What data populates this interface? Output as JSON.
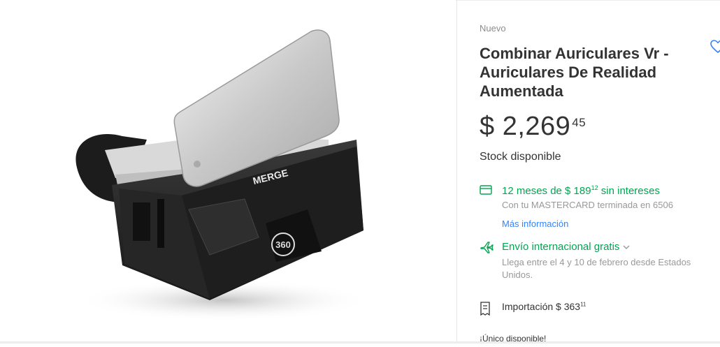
{
  "product": {
    "condition": "Nuevo",
    "title": "Combinar Auriculares Vr - Auriculares De Realidad Aumentada",
    "price_currency": "$",
    "price_integer": "2,269",
    "price_cents": "45",
    "stock": "Stock disponible",
    "image_brand_text": "MERGE",
    "image_badge_text": "360"
  },
  "installments": {
    "prefix": "12 meses de $ 189",
    "cents": "12",
    "suffix": " sin intereses",
    "card_text": "Con tu MASTERCARD terminada en 6506",
    "more_link": "Más información"
  },
  "shipping": {
    "label": "Envío internacional gratis",
    "detail": "Llega entre el 4 y 10 de febrero desde Estados Unidos."
  },
  "import": {
    "label": "Importación $ 363",
    "cents": "11"
  },
  "availability": "¡Único disponible!",
  "colors": {
    "green": "#00a650",
    "blue": "#3483fa"
  },
  "icons": [
    "heart-icon",
    "credit-card-icon",
    "airplane-icon",
    "chevron-down-icon",
    "receipt-icon"
  ]
}
